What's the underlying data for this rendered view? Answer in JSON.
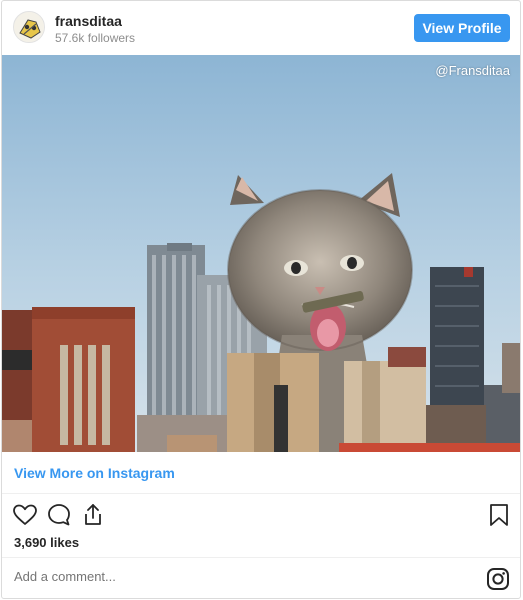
{
  "header": {
    "username": "fransditaa",
    "followers": "57.6k followers",
    "view_profile_label": "View Profile"
  },
  "photo": {
    "watermark": "@Fransditaa",
    "subject": "giant-kitten-over-city"
  },
  "view_more": {
    "label": "View More on Instagram"
  },
  "actions": {
    "icons": [
      "heart-icon",
      "comment-icon",
      "share-icon",
      "bookmark-icon"
    ],
    "likes": "3,690 likes"
  },
  "comment": {
    "placeholder": "Add a comment..."
  },
  "colors": {
    "accent": "#3897f0",
    "text": "#262626",
    "muted": "#8e8e8e"
  }
}
